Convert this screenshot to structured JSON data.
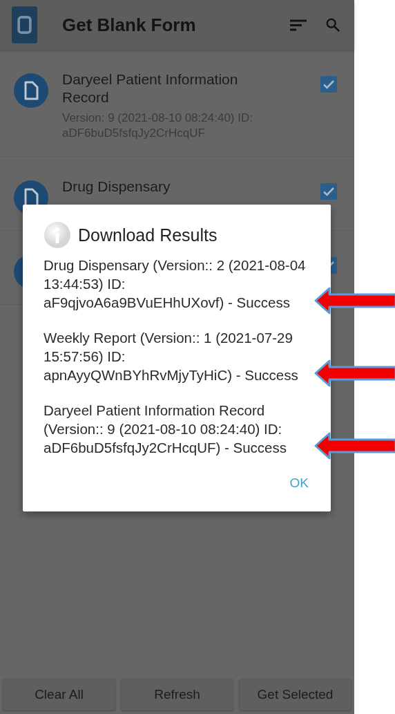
{
  "app_bar": {
    "title": "Get Blank Form"
  },
  "forms": [
    {
      "title": "Daryeel Patient Information Record",
      "subtitle": "Version: 9 (2021-08-10 08:24:40) ID: aDF6buD5fsfqJy2CrHcqUF",
      "checked": true
    },
    {
      "title": "Drug Dispensary",
      "checked": true
    },
    {
      "checked": true
    }
  ],
  "dialog": {
    "title": "Download Results",
    "messages": [
      "Drug Dispensary (Version:: 2 (2021-08-04 13:44:53) ID: aF9qjvoA6a9BVuEHhUXovf) - Success",
      "Weekly Report (Version:: 1 (2021-07-29 15:57:56) ID: apnAyyQWnBYhRvMjyTyHiC) - Success",
      "Daryeel Patient Information Record (Version:: 9 (2021-08-10 08:24:40) ID: aDF6buD5fsfqJy2CrHcqUF) - Success"
    ],
    "button": "OK"
  },
  "buttons": [
    "Clear All",
    "Refresh",
    "Get Selected"
  ]
}
